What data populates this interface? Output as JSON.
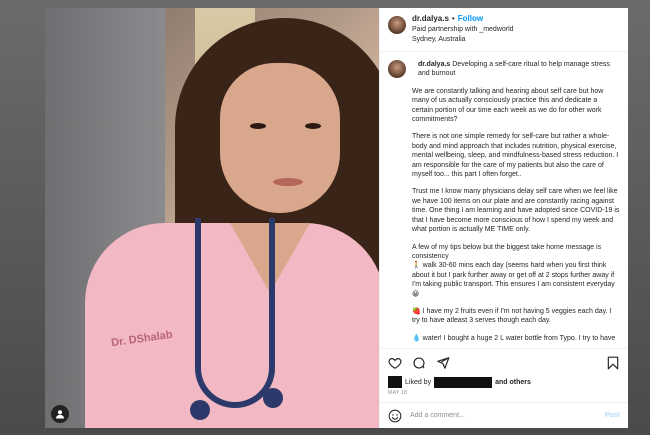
{
  "post": {
    "username": "dr.dalya.s",
    "separator": "•",
    "follow_label": "Follow",
    "partnership": "Paid partnership with _medworld",
    "location": "Sydney, Australia",
    "photo_text": "Dr. DShalab"
  },
  "caption": {
    "username": "dr.dalya.s",
    "intro": "Developing a self-care ritual to help manage stress and burnout",
    "paragraphs": [
      "We are constantly talking and hearing about self care but how many of us actually consciously practice this and dedicate a certain portion of our time each week as we do for other work commitments?",
      "There is not one simple remedy for self-care but rather a whole-body and mind approach that includes nutrition, physical exercise, mental wellbeing, sleep, and mindfulness-based stress reduction. I am responsible for the care of my patients but also the care of myself too... this part I often forget..",
      "Trust me I know many physicians delay self care when we feel like we have 100 items on our plate and are constantly racing against time. One thing I am learning and have adopted since COVID-19 is that I have become more conscious of how I spend my week and what portion is actually ME TIME only.",
      "A few of my tips below but the biggest take home message is consistency",
      "I have my 2 fruits even if I'm not having 5 veggies each day. I try to have atleast 3 serves though each day.",
      "water! I bought a huge 2 L water bottle from Typo. I try to have"
    ],
    "tip_walk": "walk 30-60 mins each day (seems hard when you first think about it but I park further away or get off at 2 stops further away if I'm taking public transport. This ensures I am consistent everyday",
    "emoji_walk": "🚶",
    "emoji_smile": "😀",
    "emoji_fruit": "🍓",
    "emoji_water": "💧"
  },
  "actions": {
    "like_icon": "heart-icon",
    "comment_icon": "comment-icon",
    "share_icon": "share-icon",
    "save_icon": "bookmark-icon"
  },
  "likes": {
    "liked_by": "Liked by",
    "and_others": "and others"
  },
  "date": "MAY 18",
  "comment": {
    "placeholder": "Add a comment...",
    "post_label": "Post"
  },
  "colors": {
    "link": "#0095f6",
    "text": "#262626",
    "muted": "#8e8e8e",
    "post_disabled": "#b2dffc",
    "backdrop": "#5a5a5a"
  }
}
